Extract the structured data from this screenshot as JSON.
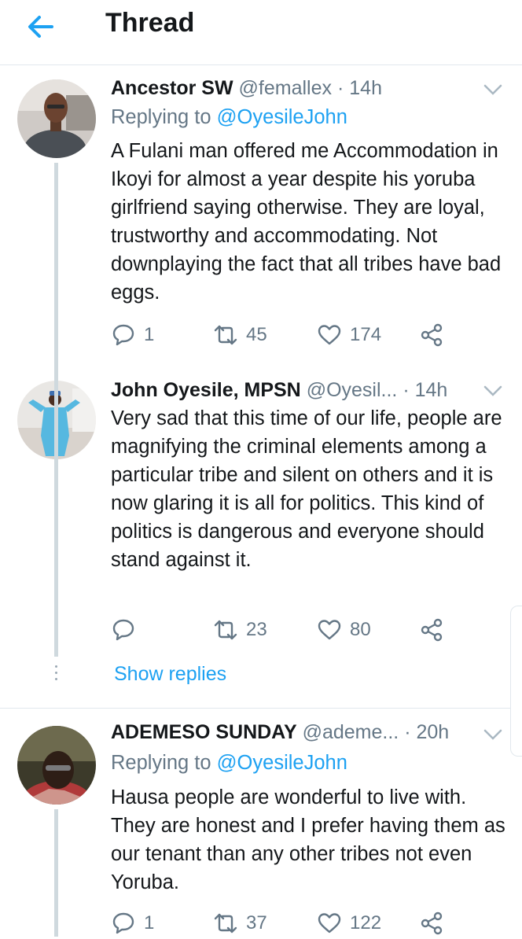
{
  "header": {
    "title": "Thread",
    "back_icon": "arrow-left-icon"
  },
  "colors": {
    "accent": "#1da1f2",
    "secondary_text": "#657786",
    "primary_text": "#14171a",
    "thread_line": "#cfd9de"
  },
  "tweets": [
    {
      "name": "Ancestor SW",
      "handle": "@femallex",
      "dot": "·",
      "time": "14h",
      "replying_prefix": "Replying to",
      "replying_to": "@OyesileJohn",
      "text": "A Fulani man offered me Accommodation in Ikoyi for almost a year despite his yoruba girlfriend saying otherwise. They are loyal, trustworthy and accommodating. Not downplaying the fact that all tribes have bad eggs.",
      "replies": "1",
      "retweets": "45",
      "likes": "174"
    },
    {
      "name": "John Oyesile, MPSN",
      "handle": "@Oyesil...",
      "dot": "·",
      "time": "14h",
      "text": "Very sad that this time of our life, people are magnifying the criminal elements among a particular tribe and silent on others and it is now glaring it is all for politics. This kind of politics is dangerous and everyone should stand against it.",
      "replies": "",
      "retweets": "23",
      "likes": "80",
      "show_replies": "Show replies"
    },
    {
      "name": "ADEMESO SUNDAY",
      "handle": "@ademe...",
      "dot": "·",
      "time": "20h",
      "replying_prefix": "Replying to",
      "replying_to": "@OyesileJohn",
      "text": "Hausa people are wonderful to live with. They are honest and I prefer having them as our tenant than any other tribes not even Yoruba.",
      "replies": "1",
      "retweets": "37",
      "likes": "122"
    }
  ]
}
